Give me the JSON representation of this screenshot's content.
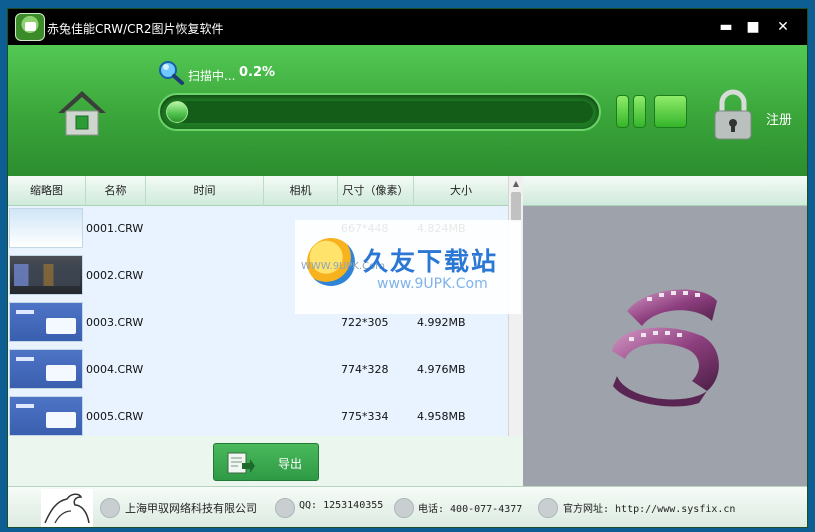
{
  "window": {
    "title": "赤兔佳能CRW/CR2图片恢复软件",
    "minimize": "▬",
    "maximize": "■",
    "close": "✕"
  },
  "scan": {
    "label": "扫描中...",
    "percent": "0.2%",
    "progress": 0.002
  },
  "register_label": "注册",
  "table": {
    "columns": [
      "缩略图",
      "名称",
      "时间",
      "相机",
      "尺寸（像素）",
      "大小"
    ],
    "rows": [
      {
        "thumb": "t-sky",
        "name": "0001.CRW",
        "dimensions": "667*448",
        "size": "4.824MB"
      },
      {
        "thumb": "t-dark",
        "name": "0002.CRW",
        "dimensions": "",
        "size": ""
      },
      {
        "thumb": "t-blue",
        "name": "0003.CRW",
        "dimensions": "722*305",
        "size": "4.992MB"
      },
      {
        "thumb": "t-blue",
        "name": "0004.CRW",
        "dimensions": "774*328",
        "size": "4.976MB"
      },
      {
        "thumb": "t-blue",
        "name": "0005.CRW",
        "dimensions": "775*334",
        "size": "4.958MB"
      }
    ]
  },
  "export_label": "导出",
  "watermark": {
    "title": "久友下载站",
    "url": "www.9UPK.Com",
    "url_small": "WWW.9UPK.Com"
  },
  "footer": {
    "company": "上海甲驭网络科技有限公司",
    "qq": "QQ: 1253140355",
    "phone": "电话: 400-077-4377",
    "website": "官方网址: http://www.sysfix.cn"
  },
  "colors": {
    "header_green": "#3aa53a",
    "accent_green": "#2f9a45",
    "watermark_blue": "#2a77d4"
  }
}
